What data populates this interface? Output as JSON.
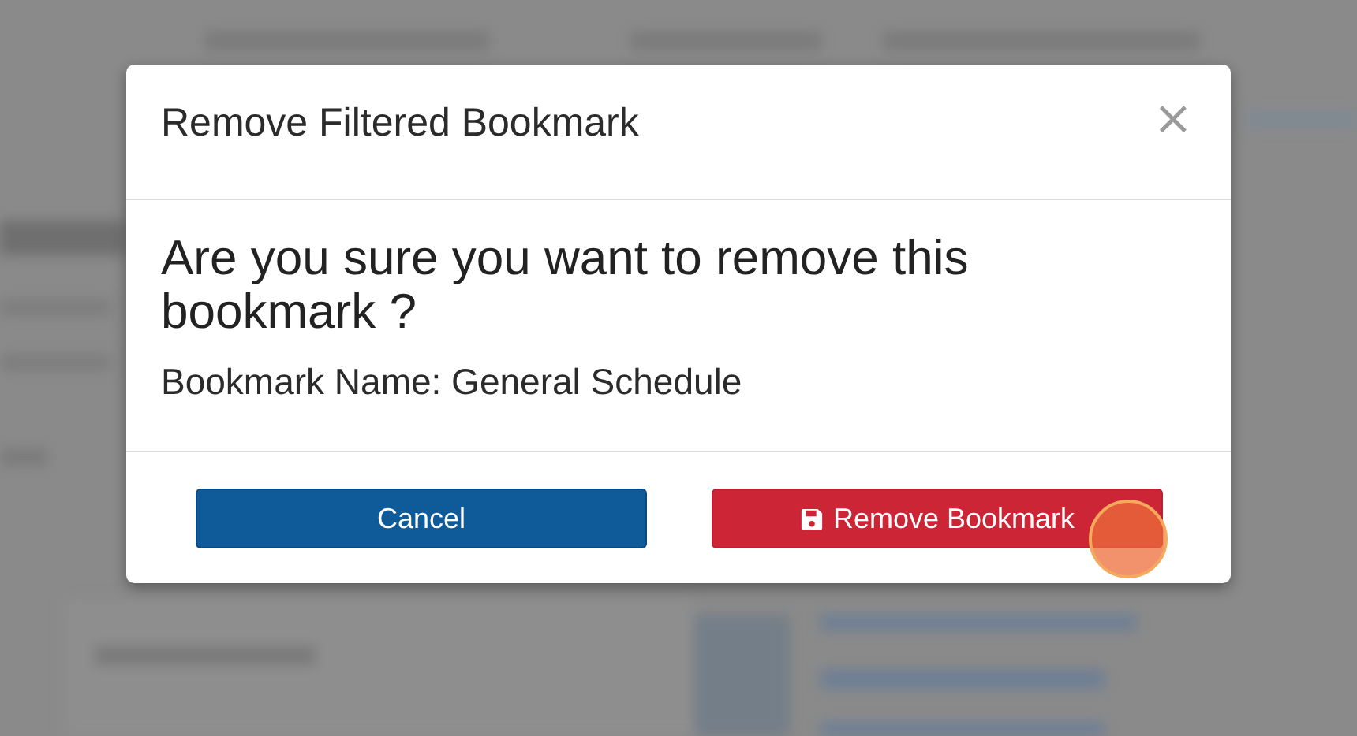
{
  "dialog": {
    "title": "Remove Filtered Bookmark",
    "close": "×",
    "question": "Are you sure you want to remove this bookmark ?",
    "detail": "Bookmark Name: General Schedule",
    "buttons": [
      {
        "kind": "cancel",
        "label": "Cancel"
      },
      {
        "kind": "danger",
        "label": "Remove Bookmark"
      }
    ]
  }
}
